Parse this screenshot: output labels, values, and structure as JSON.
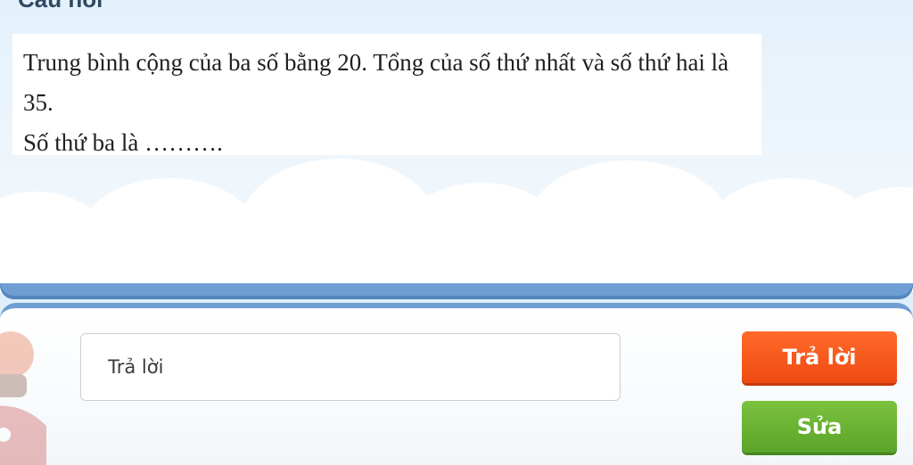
{
  "header": {
    "title": "Câu hỏi"
  },
  "question": {
    "text": "Trung bình cộng của ba số bằng 20. Tổng của số thứ nhất và số thứ hai là 35.",
    "prompt": "Số thứ ba là ………."
  },
  "answer": {
    "placeholder": "Trả lời",
    "value": ""
  },
  "buttons": {
    "submit_label": "Trả lời",
    "edit_label": "Sửa"
  },
  "colors": {
    "submit": "#ef4a12",
    "edit": "#5aa42a",
    "divider": "#6e9ed2"
  }
}
